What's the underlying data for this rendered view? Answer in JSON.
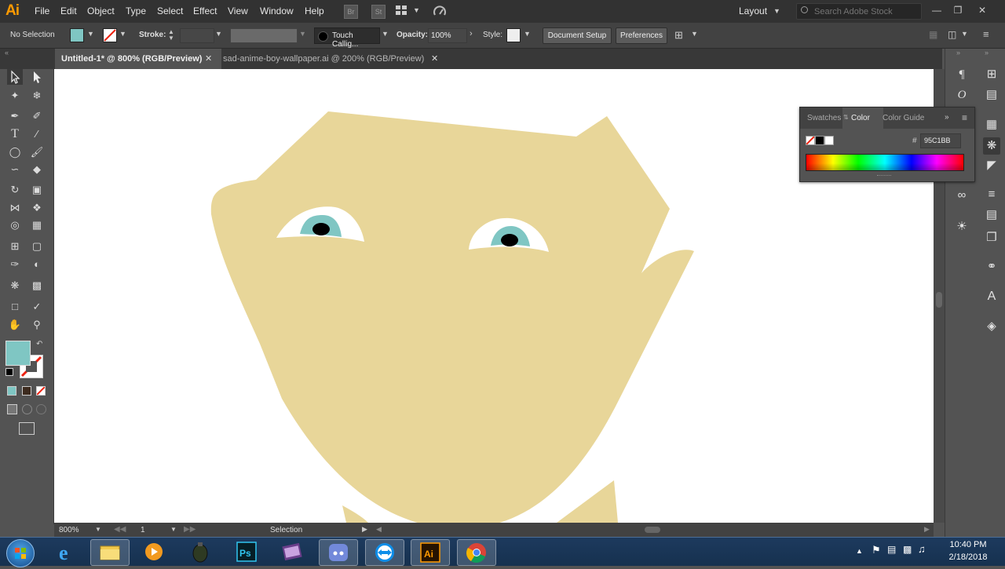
{
  "app": {
    "logo": "Ai"
  },
  "menus": [
    "File",
    "Edit",
    "Object",
    "Type",
    "Select",
    "Effect",
    "View",
    "Window",
    "Help"
  ],
  "workspace": {
    "label": "Layout"
  },
  "search": {
    "placeholder": "Search Adobe Stock"
  },
  "control_bar": {
    "selection": "No Selection",
    "stroke_label": "Stroke:",
    "brush": "Touch Callig...",
    "opacity_label": "Opacity:",
    "opacity_value": "100%",
    "style_label": "Style:",
    "document_setup": "Document Setup",
    "preferences": "Preferences",
    "fill_color": "#7fc6c3"
  },
  "tabs": [
    {
      "label": "Untitled-1* @ 800% (RGB/Preview)",
      "active": true
    },
    {
      "label": "sad-anime-boy-wallpaper.ai @ 200% (RGB/Preview)",
      "active": false
    }
  ],
  "color_panel": {
    "tabs": [
      "Swatches",
      "Color",
      "Color Guide"
    ],
    "active_tab": "Color",
    "hash": "#",
    "hex": "95C1BB"
  },
  "status": {
    "zoom": "800%",
    "artboard": "1",
    "tool": "Selection"
  },
  "artwork": {
    "skin_color": "#e8d699",
    "iris_color": "#7fc6c3",
    "pupil_color": "#000000"
  },
  "taskbar": {
    "apps": [
      "start-orb",
      "internet-explorer",
      "file-explorer",
      "media-player",
      "grenade-app",
      "photoshop",
      "movie-maker",
      "discord",
      "teamviewer",
      "illustrator",
      "chrome"
    ],
    "time": "10:40 PM",
    "date": "2/18/2018"
  }
}
